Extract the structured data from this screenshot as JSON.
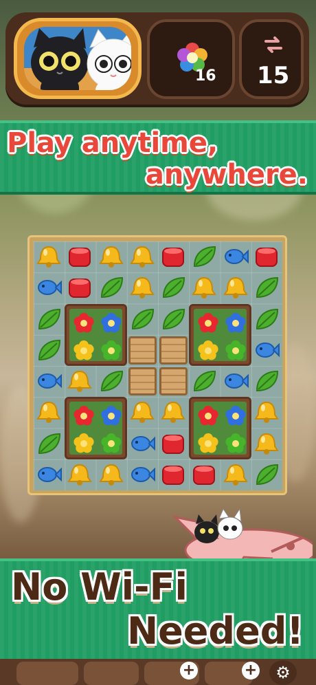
{
  "hud": {
    "moves_count": "16",
    "swap_count": "15"
  },
  "banner_top": {
    "line1": "Play anytime,",
    "line2": "anywhere."
  },
  "banner_bottom": {
    "line1": "No Wi-Fi",
    "line2": "Needed!"
  },
  "board": {
    "rows": [
      [
        "bell",
        "jelly",
        "bell",
        "bell",
        "jelly",
        "leaf",
        "fish",
        "jelly"
      ],
      [
        "fish",
        "jelly",
        "leaf",
        "bell",
        "leaf",
        "bell",
        "bell",
        "leaf"
      ],
      [
        "leaf",
        "garden",
        "garden",
        "leaf",
        "leaf",
        "garden",
        "garden",
        "leaf"
      ],
      [
        "leaf",
        "garden",
        "garden",
        "crate",
        "crate",
        "garden",
        "garden",
        "fish"
      ],
      [
        "fish",
        "bell",
        "leaf",
        "crate",
        "crate",
        "leaf",
        "fish",
        "leaf"
      ],
      [
        "bell",
        "garden",
        "garden",
        "bell",
        "bell",
        "garden",
        "garden",
        "bell"
      ],
      [
        "leaf",
        "garden",
        "garden",
        "fish",
        "jelly",
        "garden",
        "garden",
        "bell"
      ],
      [
        "fish",
        "bell",
        "bell",
        "fish",
        "jelly",
        "jelly",
        "bell",
        "leaf"
      ]
    ]
  },
  "colors": {
    "banner_green": "#1f9d62",
    "red_text": "#e8473a",
    "brown_text": "#4c2a16",
    "hud_brown": "#4a2d1d"
  }
}
